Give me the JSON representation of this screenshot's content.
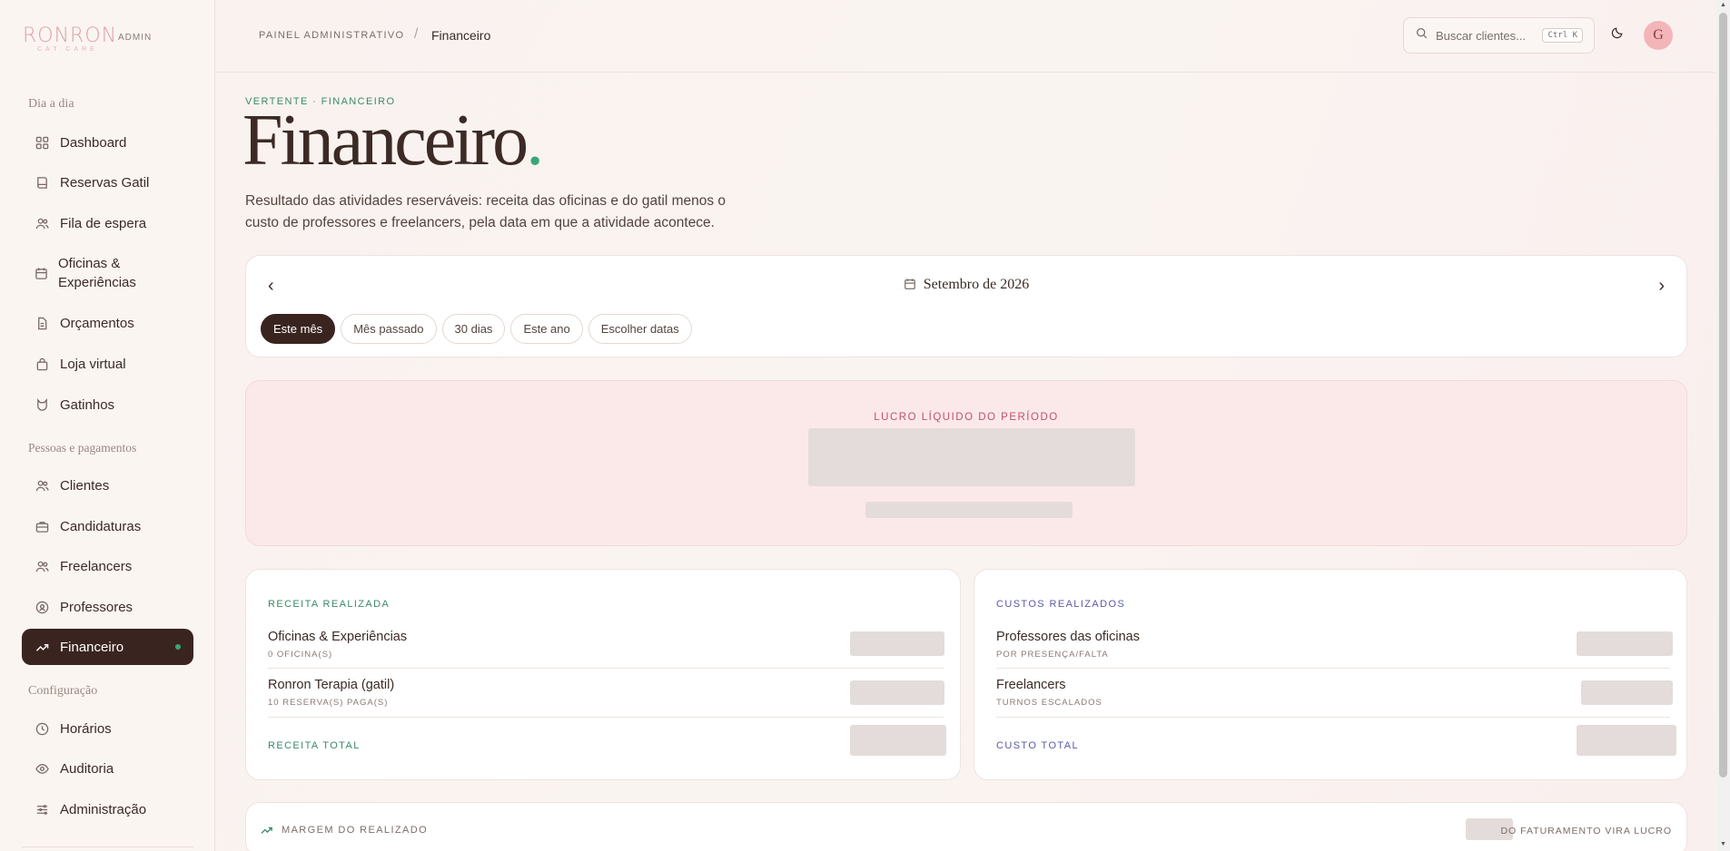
{
  "brand": {
    "name": "RONRON",
    "tagline": "CAT CARE",
    "admin": "ADMIN"
  },
  "sidebar": {
    "sections": [
      "Dia a dia",
      "Pessoas e pagamentos",
      "Configuração"
    ],
    "items": [
      {
        "label": "Dashboard",
        "icon": "grid-icon"
      },
      {
        "label": "Reservas Gatil",
        "icon": "book-icon"
      },
      {
        "label": "Fila de espera",
        "icon": "users-icon"
      },
      {
        "label": "Oficinas & Experiências",
        "icon": "calendar-icon"
      },
      {
        "label": "Orçamentos",
        "icon": "file-icon"
      },
      {
        "label": "Loja virtual",
        "icon": "bag-icon"
      },
      {
        "label": "Gatinhos",
        "icon": "cat-icon"
      },
      {
        "label": "Clientes",
        "icon": "users-icon"
      },
      {
        "label": "Candidaturas",
        "icon": "briefcase-icon"
      },
      {
        "label": "Freelancers",
        "icon": "users-icon"
      },
      {
        "label": "Professores",
        "icon": "badge-icon"
      },
      {
        "label": "Financeiro",
        "icon": "trending-up-icon",
        "active": true
      },
      {
        "label": "Horários",
        "icon": "clock-icon"
      },
      {
        "label": "Auditoria",
        "icon": "eye-icon"
      },
      {
        "label": "Administração",
        "icon": "sliders-icon"
      }
    ]
  },
  "topbar": {
    "breadcrumb_root": "PAINEL ADMINISTRATIVO",
    "breadcrumb_sep": "/",
    "breadcrumb_current": "Financeiro",
    "search_placeholder": "Buscar clientes...",
    "search_shortcut": "Ctrl K",
    "avatar_initial": "G"
  },
  "header": {
    "eyebrow": "VERTENTE · FINANCEIRO",
    "title": "Financeiro",
    "title_dot": ".",
    "description": "Resultado das atividades reserváveis: receita das oficinas e do gatil menos o custo de professores e freelancers, pela data em que a atividade acontece."
  },
  "period": {
    "prev": "‹",
    "next": "›",
    "month_label": "Setembro de 2026",
    "chips": [
      "Este mês",
      "Mês passado",
      "30 dias",
      "Este ano",
      "Escolher datas"
    ],
    "selected_chip": "Este mês"
  },
  "profit": {
    "label": "LUCRO LÍQUIDO DO PERÍODO"
  },
  "revenue": {
    "title": "RECEITA REALIZADA",
    "rows": [
      {
        "label": "Oficinas & Experiências",
        "sub": "0 OFICINA(S)"
      },
      {
        "label": "Ronron Terapia (gatil)",
        "sub": "10 RESERVA(S) PAGA(S)"
      }
    ],
    "total_label": "RECEITA TOTAL"
  },
  "costs": {
    "title": "CUSTOS REALIZADOS",
    "rows": [
      {
        "label": "Professores das oficinas",
        "sub": "POR PRESENÇA/FALTA"
      },
      {
        "label": "Freelancers",
        "sub": "TURNOS ESCALADOS"
      }
    ],
    "total_label": "CUSTO TOTAL"
  },
  "margin": {
    "label": "MARGEM DO REALIZADO",
    "note": "DO FATURAMENTO VIRA LUCRO"
  },
  "colors": {
    "brand_pink": "#e0a0a3",
    "accent_green": "#3aa676",
    "revenue_green": "#3a8a68",
    "cost_purple": "#5a5aa8",
    "profit_red": "#c0506a",
    "dark": "#3a2420"
  }
}
